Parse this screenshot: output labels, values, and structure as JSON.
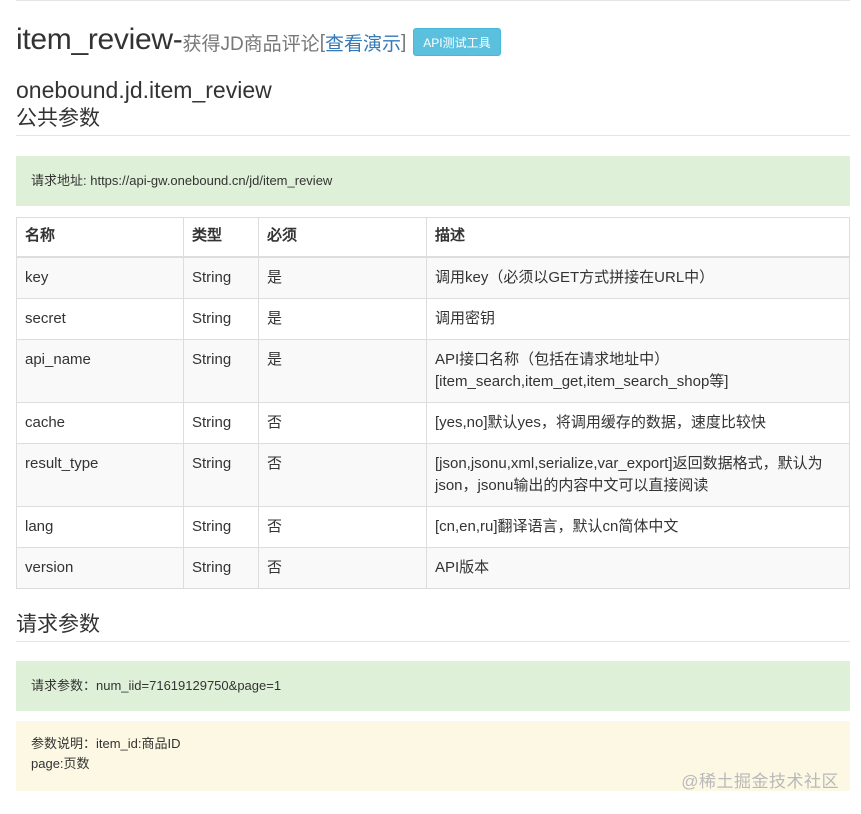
{
  "header": {
    "title_main": "item_review-",
    "title_sub": "获得JD商品评论",
    "bracket_open": " [",
    "demo_link": "查看演示",
    "bracket_close": "]",
    "api_button": "API测试工具"
  },
  "method_name": "onebound.jd.item_review",
  "public_params": {
    "heading": "公共参数",
    "request_url": "请求地址: https://api-gw.onebound.cn/jd/item_review",
    "columns": [
      "名称",
      "类型",
      "必须",
      "描述"
    ],
    "rows": [
      {
        "name": "key",
        "type": "String",
        "required": "是",
        "desc": "调用key（必须以GET方式拼接在URL中）"
      },
      {
        "name": "secret",
        "type": "String",
        "required": "是",
        "desc": "调用密钥"
      },
      {
        "name": "api_name",
        "type": "String",
        "required": "是",
        "desc": "API接口名称（包括在请求地址中）[item_search,item_get,item_search_shop等]"
      },
      {
        "name": "cache",
        "type": "String",
        "required": "否",
        "desc": "[yes,no]默认yes，将调用缓存的数据，速度比较快"
      },
      {
        "name": "result_type",
        "type": "String",
        "required": "否",
        "desc": "[json,jsonu,xml,serialize,var_export]返回数据格式，默认为json，jsonu输出的内容中文可以直接阅读"
      },
      {
        "name": "lang",
        "type": "String",
        "required": "否",
        "desc": "[cn,en,ru]翻译语言，默认cn简体中文"
      },
      {
        "name": "version",
        "type": "String",
        "required": "否",
        "desc": "API版本"
      }
    ]
  },
  "request_params": {
    "heading": "请求参数",
    "params_line": "请求参数：num_iid=71619129750&page=1",
    "desc_line_1": "参数说明：item_id:商品ID",
    "desc_line_2": "page:页数"
  },
  "watermark": "@稀土掘金技术社区",
  "colors": {
    "success_bg": "#dff0d8",
    "warning_bg": "#fcf8e3",
    "link": "#337ab7",
    "info_button": "#5bc0de"
  }
}
